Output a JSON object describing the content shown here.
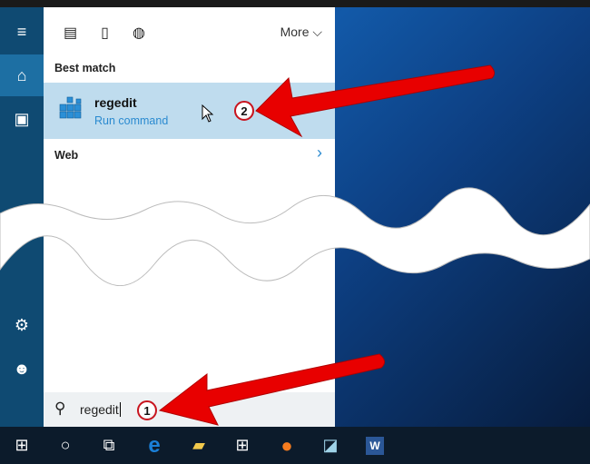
{
  "panel": {
    "more_label": "More",
    "best_match_label": "Best match",
    "web_label": "Web"
  },
  "result": {
    "name": "regedit",
    "subtitle": "Run command"
  },
  "search": {
    "value": "regedit"
  },
  "annotations": {
    "step1": "1",
    "step2": "2"
  },
  "taskbar": {
    "word_label": "W"
  },
  "colors": {
    "rail": "#0f4a72",
    "highlight": "#bfdcee",
    "accent": "#2a8ad0",
    "arrow": "#e80000"
  }
}
